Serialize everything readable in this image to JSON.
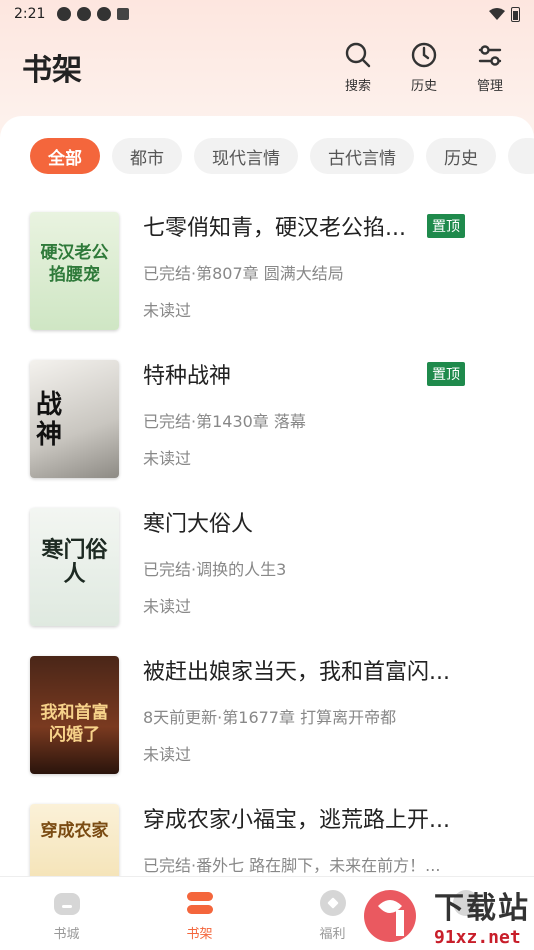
{
  "status_bar": {
    "time": "2:21"
  },
  "header": {
    "title": "书架",
    "actions": [
      {
        "label": "搜索",
        "icon": "search-icon"
      },
      {
        "label": "历史",
        "icon": "clock-icon"
      },
      {
        "label": "管理",
        "icon": "sliders-icon"
      }
    ]
  },
  "tabs": [
    {
      "label": "全部",
      "active": true
    },
    {
      "label": "都市",
      "active": false
    },
    {
      "label": "现代言情",
      "active": false
    },
    {
      "label": "古代言情",
      "active": false
    },
    {
      "label": "历史",
      "active": false
    }
  ],
  "books": [
    {
      "title": "七零俏知青，硬汉老公掐...",
      "pin": "置顶",
      "info": "已完结·第807章 圆满大结局",
      "status": "未读过",
      "cover_text": "硬汉老公掐腰宠"
    },
    {
      "title": "特种战神",
      "pin": "置顶",
      "info": "已完结·第1430章 落幕",
      "status": "未读过",
      "cover_text": "战神"
    },
    {
      "title": "寒门大俗人",
      "pin": "",
      "info": "已完结·调换的人生3",
      "status": "未读过",
      "cover_text": "寒门俗人"
    },
    {
      "title": "被赶出娘家当天，我和首富闪...",
      "pin": "",
      "info": "8天前更新·第1677章 打算离开帝都",
      "status": "未读过",
      "cover_text": "我和首富闪婚了"
    },
    {
      "title": "穿成农家小福宝，逃荒路上开...",
      "pin": "",
      "info": "已完结·番外七 路在脚下，未来在前方！...",
      "status": "",
      "cover_text": "穿成农家"
    }
  ],
  "bottom_nav": [
    {
      "label": "书城",
      "active": false
    },
    {
      "label": "书架",
      "active": true
    },
    {
      "label": "福利",
      "active": false
    },
    {
      "label": "",
      "active": false
    }
  ],
  "watermark": {
    "main": "下载站",
    "sub": "91xz.net"
  },
  "colors": {
    "accent": "#f4663c",
    "pin": "#1f8a4c"
  }
}
